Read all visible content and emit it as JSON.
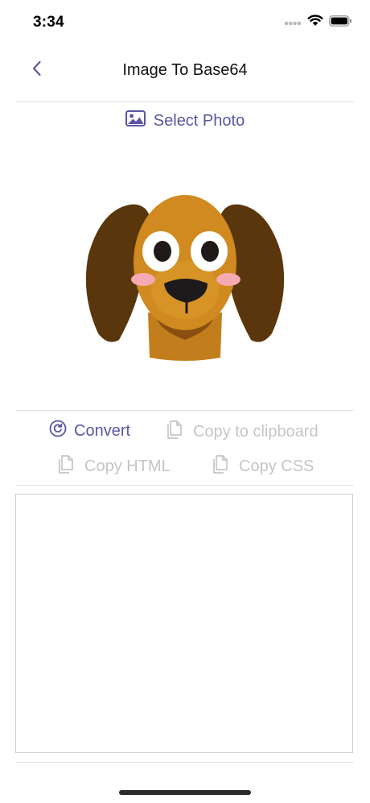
{
  "status_bar": {
    "time": "3:34",
    "icons": [
      "signal-dots-icon",
      "wifi-icon",
      "battery-icon"
    ]
  },
  "nav": {
    "title": "Image To Base64",
    "back_icon": "chevron-left-icon"
  },
  "select_photo": {
    "label": "Select Photo",
    "icon": "photo-icon"
  },
  "image": {
    "subject": "dog-illustration"
  },
  "actions": {
    "convert": {
      "label": "Convert",
      "icon": "refresh-circle-icon",
      "enabled": true
    },
    "copy_clipboard": {
      "label": "Copy to clipboard",
      "icon": "copy-icon",
      "enabled": false
    },
    "copy_html": {
      "label": "Copy HTML",
      "icon": "copy-icon",
      "enabled": false
    },
    "copy_css": {
      "label": "Copy CSS",
      "icon": "copy-icon",
      "enabled": false
    }
  },
  "output": {
    "value": ""
  },
  "colors": {
    "accent": "#5856a6",
    "disabled": "#c5c5c9",
    "divider": "#e3e3e6"
  }
}
